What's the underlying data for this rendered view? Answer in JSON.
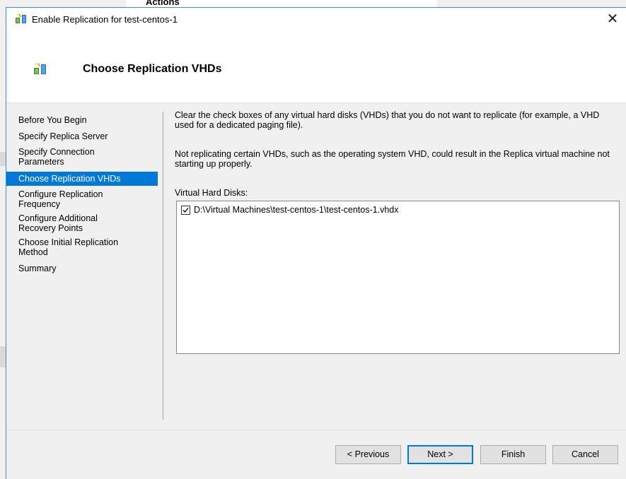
{
  "background": {
    "actions_label": "Actions"
  },
  "window": {
    "title": "Enable Replication for test-centos-1",
    "close_glyph": "✕"
  },
  "header": {
    "title": "Choose Replication VHDs"
  },
  "nav": {
    "items": [
      {
        "label": "Before You Begin"
      },
      {
        "label": "Specify Replica Server"
      },
      {
        "label": "Specify Connection Parameters"
      },
      {
        "label": "Choose Replication VHDs",
        "selected": true
      },
      {
        "label": "Configure Replication Frequency"
      },
      {
        "label": "Configure Additional Recovery Points"
      },
      {
        "label": "Choose Initial Replication Method"
      },
      {
        "label": "Summary"
      }
    ]
  },
  "content": {
    "paragraph1": "Clear the check boxes of any virtual hard disks (VHDs) that you do not want to replicate (for example, a VHD used for a dedicated paging file).",
    "paragraph2": "Not replicating certain VHDs, such as the operating system VHD, could result in the Replica virtual machine not starting up properly.",
    "vhd_label": "Virtual Hard Disks:",
    "vhds": [
      {
        "path": "D:\\Virtual Machines\\test-centos-1\\test-centos-1.vhdx",
        "checked": true
      }
    ]
  },
  "buttons": {
    "previous": "< Previous",
    "next": "Next >",
    "finish": "Finish",
    "cancel": "Cancel"
  },
  "colors": {
    "selection": "#0078d7",
    "accent_border": "#3c8fd6"
  }
}
